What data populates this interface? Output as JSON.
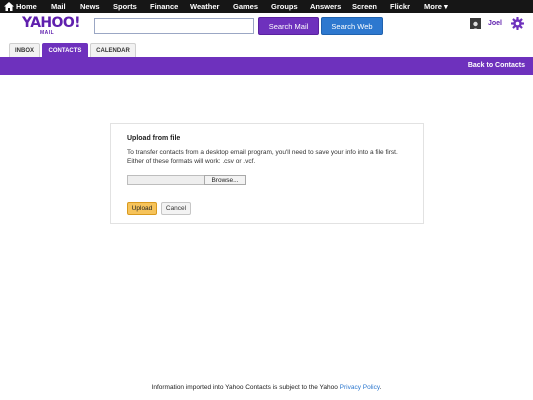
{
  "topnav": {
    "items": [
      "Home",
      "Mail",
      "News",
      "Sports",
      "Finance",
      "Weather",
      "Games",
      "Groups",
      "Answers",
      "Screen",
      "Flickr",
      "More"
    ],
    "more_caret": "▾"
  },
  "header": {
    "logo_text": "YAHOO!",
    "logo_sub": "MAIL",
    "search_value": "",
    "search_mail_label": "Search Mail",
    "search_web_label": "Search Web",
    "username": "Joel"
  },
  "tabs": [
    {
      "label": "INBOX",
      "active": false
    },
    {
      "label": "CONTACTS",
      "active": true
    },
    {
      "label": "CALENDAR",
      "active": false
    }
  ],
  "subbar": {
    "back_label": "Back to Contacts"
  },
  "upload_dialog": {
    "title": "Upload from file",
    "description": "To transfer contacts from a desktop email program, you'll need to save your info into a file first. Either of these formats will work: .csv or .vcf.",
    "file_value": "",
    "browse_label": "Browse...",
    "upload_label": "Upload",
    "cancel_label": "Cancel"
  },
  "footer": {
    "text": "Information imported into Yahoo Contacts is subject to the Yahoo ",
    "link": "Privacy Policy",
    "end": "."
  },
  "colors": {
    "brand_purple": "#6e31bd",
    "search_web_blue": "#2d78cf",
    "upload_yellow": "#f6c35a",
    "topnav_bg": "#161616"
  }
}
